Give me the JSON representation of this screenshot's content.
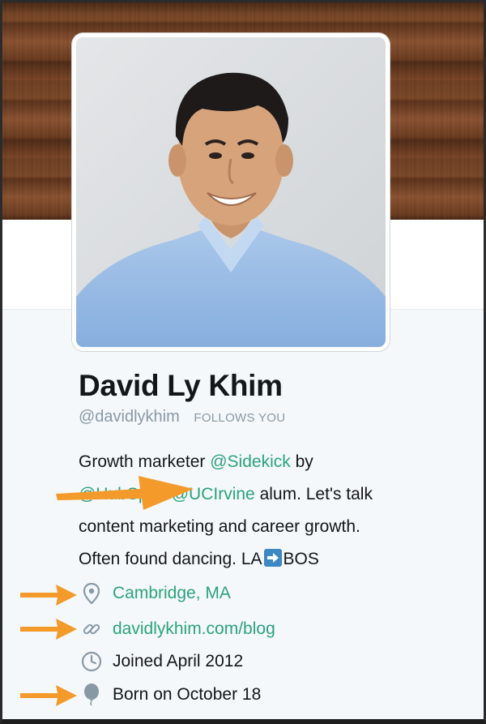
{
  "profile": {
    "name": "David Ly Khim",
    "handle": "@davidlykhim",
    "follows_badge": "FOLLOWS YOU",
    "bio": {
      "line1_prefix": "Growth marketer ",
      "line1_mention": "@Sidekick",
      "line1_suffix": " by",
      "line2_mention_obscured": "@HubSpot",
      "line2_sep": ". ",
      "line2_mention": "@UCIrvine",
      "line2_suffix": " alum. Let's talk",
      "line3": "content marketing and career growth.",
      "line4_prefix": "Often found dancing. LA",
      "line4_suffix": "BOS"
    },
    "location": "Cambridge, MA",
    "website": "davidlykhim.com/blog",
    "joined": "Joined April 2012",
    "birthday": "Born on October 18"
  },
  "icons": {
    "location": "map-pin-icon",
    "website": "link-icon",
    "joined": "clock-icon",
    "birthday": "balloon-icon",
    "emoji": "right-arrow-emoji-icon",
    "annotation": "orange-arrow-icon"
  },
  "colors": {
    "link": "#2aa37a",
    "text": "#14171a",
    "muted": "#8899a6",
    "panel": "#f5f8fa",
    "annotation": "#f39a2a"
  }
}
